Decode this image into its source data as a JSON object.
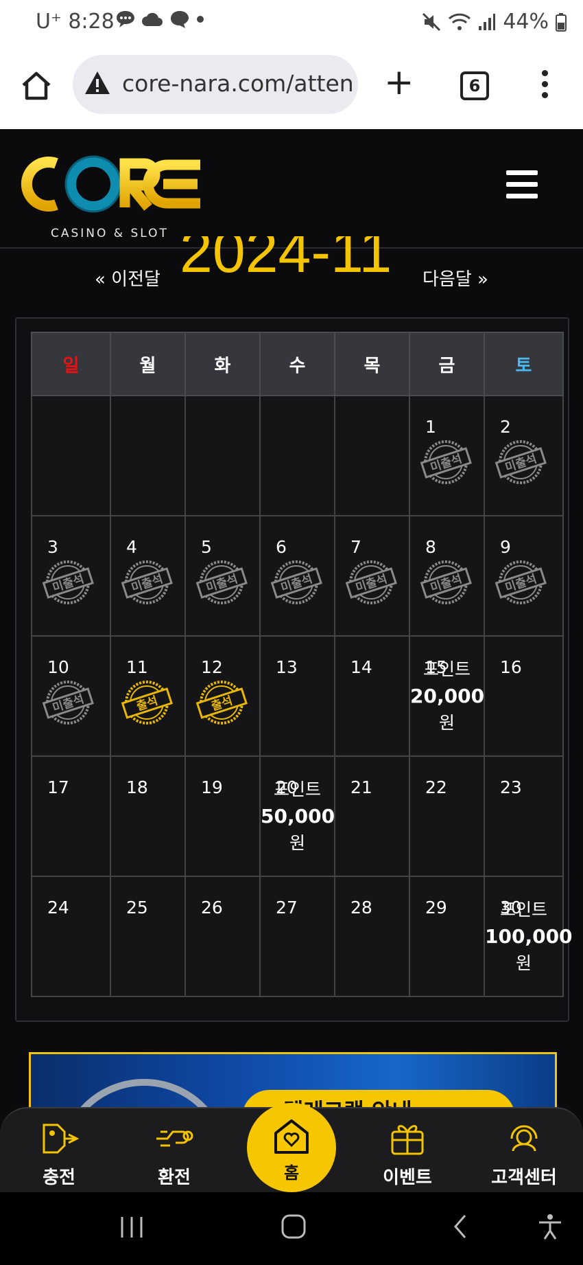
{
  "status_bar": {
    "carrier": "U⁺",
    "time": "8:28",
    "battery": "44%"
  },
  "browser": {
    "url": "core-nara.com/atten",
    "tab_count": "6"
  },
  "site": {
    "logo_text": "CORE",
    "logo_sub": "CASINO & SLOT"
  },
  "calendar_nav": {
    "prev": "« 이전달",
    "title": "2024-11",
    "next": "다음달 »"
  },
  "weekdays": [
    "일",
    "월",
    "화",
    "수",
    "목",
    "금",
    "토"
  ],
  "weeks": [
    [
      {
        "day": ""
      },
      {
        "day": ""
      },
      {
        "day": ""
      },
      {
        "day": ""
      },
      {
        "day": ""
      },
      {
        "day": "1",
        "stamp": "미출석"
      },
      {
        "day": "2",
        "stamp": "미출석"
      }
    ],
    [
      {
        "day": "3",
        "stamp": "미출석"
      },
      {
        "day": "4",
        "stamp": "미출석"
      },
      {
        "day": "5",
        "stamp": "미출석"
      },
      {
        "day": "6",
        "stamp": "미출석"
      },
      {
        "day": "7",
        "stamp": "미출석"
      },
      {
        "day": "8",
        "stamp": "미출석"
      },
      {
        "day": "9",
        "stamp": "미출석"
      }
    ],
    [
      {
        "day": "10",
        "stamp": "미출석"
      },
      {
        "day": "11",
        "stamp": "출석"
      },
      {
        "day": "12",
        "stamp": "출석"
      },
      {
        "day": "13"
      },
      {
        "day": "14"
      },
      {
        "day": "15",
        "reward": [
          "포인트",
          "20,000",
          "원"
        ]
      },
      {
        "day": "16"
      }
    ],
    [
      {
        "day": "17"
      },
      {
        "day": "18"
      },
      {
        "day": "19"
      },
      {
        "day": "20",
        "reward": [
          "포인트",
          "50,000",
          "원"
        ]
      },
      {
        "day": "21"
      },
      {
        "day": "22"
      },
      {
        "day": "23"
      }
    ],
    [
      {
        "day": "24"
      },
      {
        "day": "25"
      },
      {
        "day": "26"
      },
      {
        "day": "27"
      },
      {
        "day": "28"
      },
      {
        "day": "29"
      },
      {
        "day": "30",
        "reward": [
          "포인트",
          "100,000",
          "원"
        ]
      }
    ]
  ],
  "banner": {
    "text": "텔레그램 안내"
  },
  "bottom_nav": {
    "charge": "충전",
    "exchange": "환전",
    "home": "홈",
    "event": "이벤트",
    "support": "고객센터"
  },
  "colors": {
    "gold": "#f5c400",
    "sunday": "#e11111",
    "saturday": "#4cb8f0",
    "stamp_gray": "#8a8a8a",
    "stamp_gold": "#e8b800"
  }
}
